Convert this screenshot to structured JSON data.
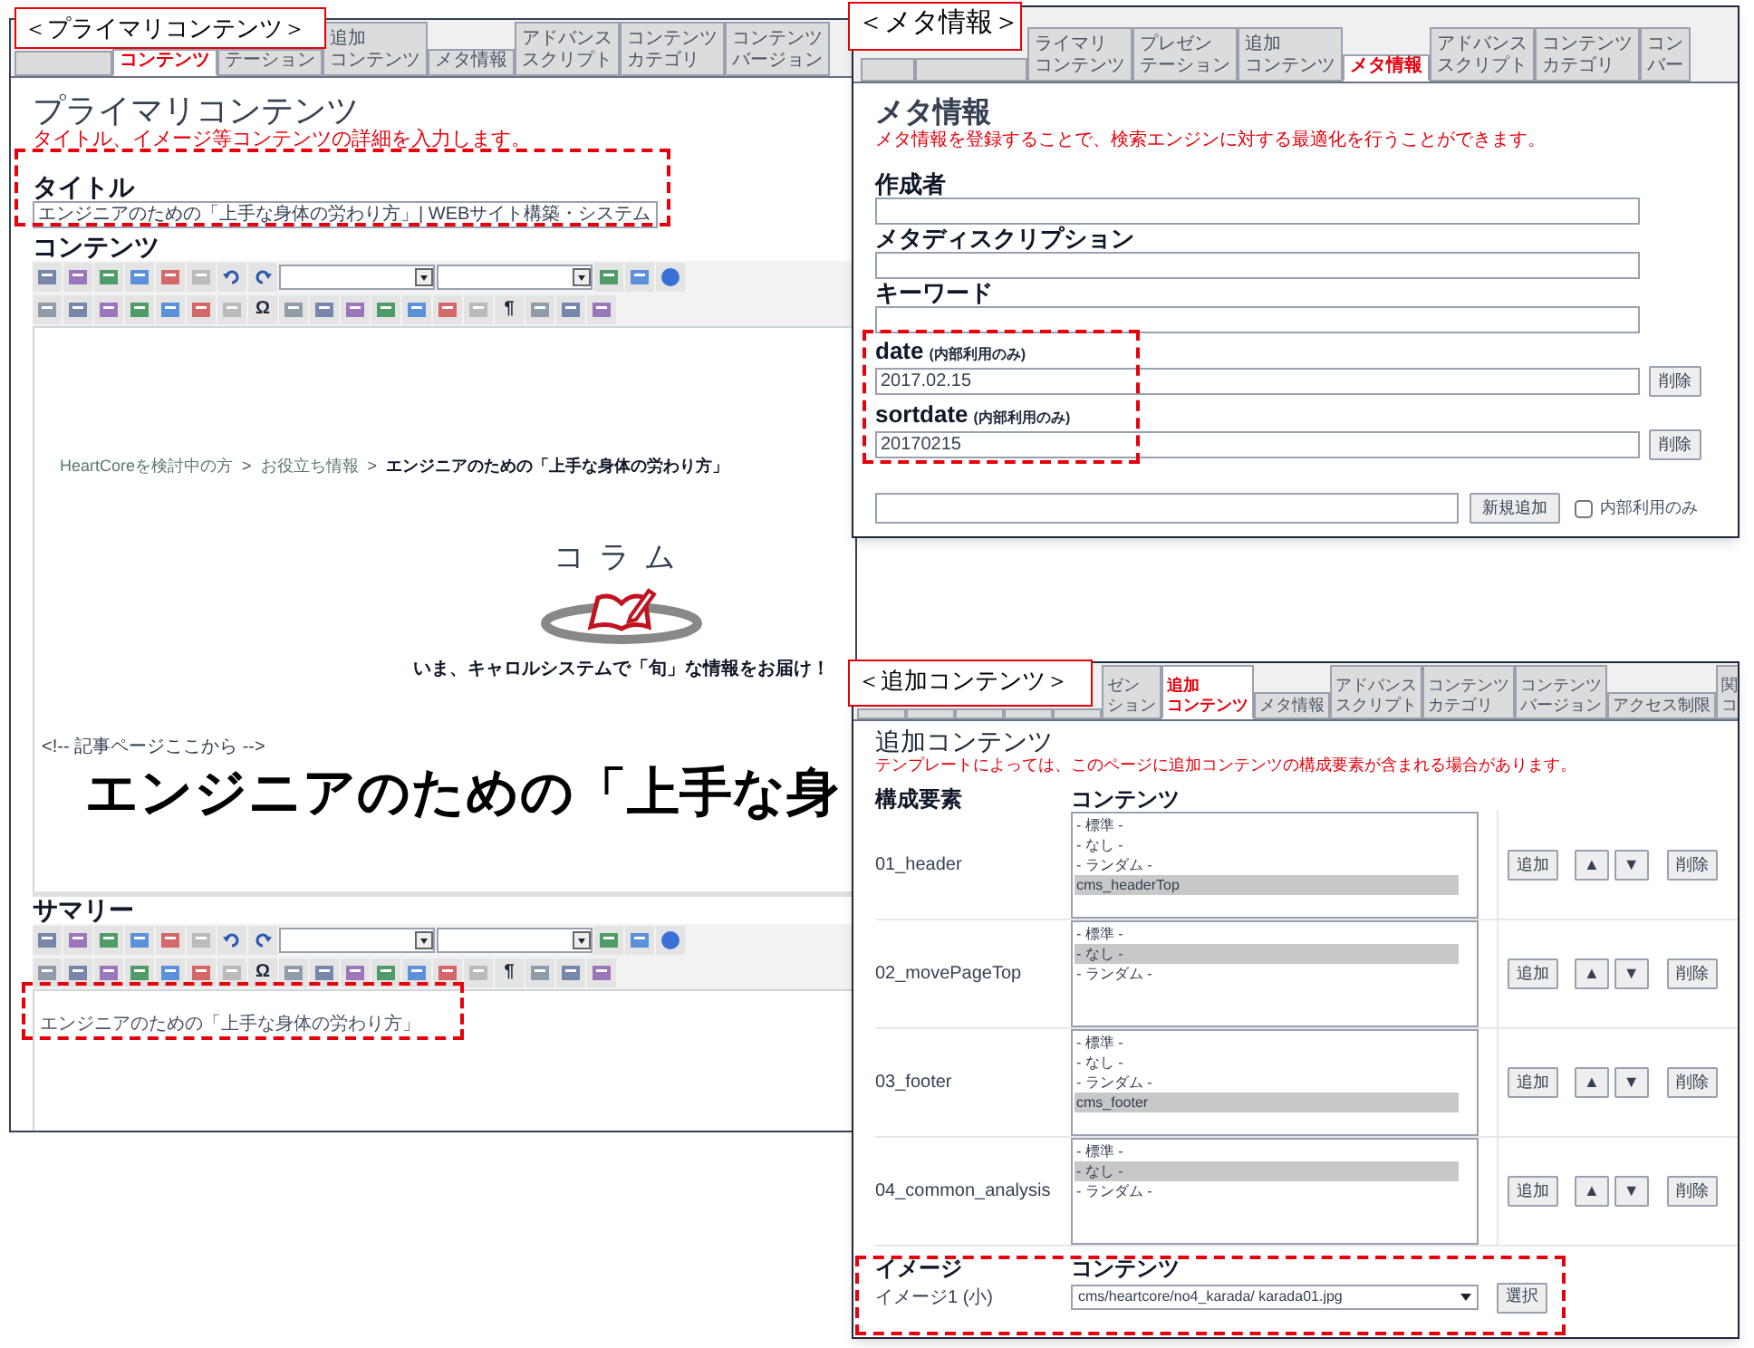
{
  "panels": [
    {
      "kind": "primary",
      "label": "＜プライマリコンテンツ＞",
      "tabs": [
        {
          "lines": [
            "コンテンツ"
          ],
          "selected": true
        },
        {
          "lines": [
            "テーション"
          ],
          "selected": false
        },
        {
          "lines": [
            "追加",
            "コンテンツ"
          ],
          "selected": false
        },
        {
          "lines": [
            "メタ情報"
          ],
          "selected": false
        },
        {
          "lines": [
            "アドバンス",
            "スクリプト"
          ],
          "selected": false
        },
        {
          "lines": [
            "コンテンツ",
            "カテゴリ"
          ],
          "selected": false
        },
        {
          "lines": [
            "コンテンツ",
            "バージョン"
          ],
          "selected": false
        }
      ],
      "title": "プライマリコンテンツ",
      "description": "タイトル、イメージ等コンテンツの詳細を入力します。",
      "title_field": {
        "label": "タイトル",
        "value": "エンジニアのための「上手な身体の労わり方」| WEBサイト構築・システム"
      },
      "content_label": "コンテンツ",
      "toolbar_symbols": [
        "Ω",
        "¶"
      ],
      "editor": {
        "separator": ">",
        "breadcrumb": [
          {
            "text": "HeartCoreを検討中の方",
            "current": false
          },
          {
            "text": "お役立ち情報",
            "current": false
          },
          {
            "text": "エンジニアのための「上手な身体の労わり方」",
            "current": true
          }
        ],
        "logo_text": "コラム",
        "tagline": "いま、キャロルシステムで「旬」な情報をお届け！",
        "comment": "<!-- 記事ページここから -->",
        "heading": "エンジニアのための「上手な身"
      },
      "summary_label": "サマリー",
      "summary_toolbar_symbols": [
        "Ω",
        "¶"
      ],
      "summary_text": "エンジニアのための「上手な身体の労わり方」"
    },
    {
      "kind": "meta",
      "label": "＜メタ情報＞",
      "tabs": [
        {
          "lines": [
            "ライマリ",
            "コンテンツ"
          ],
          "selected": false
        },
        {
          "lines": [
            "プレゼン",
            "テーション"
          ],
          "selected": false
        },
        {
          "lines": [
            "追加",
            "コンテンツ"
          ],
          "selected": false
        },
        {
          "lines": [
            "メタ情報"
          ],
          "selected": true
        },
        {
          "lines": [
            "アドバンス",
            "スクリプト"
          ],
          "selected": false
        },
        {
          "lines": [
            "コンテンツ",
            "カテゴリ"
          ],
          "selected": false
        },
        {
          "lines": [
            "コン",
            "バー"
          ],
          "selected": false
        }
      ],
      "title": "メタ情報",
      "description": "メタ情報を登録することで、検索エンジンに対する最適化を行うことができます。",
      "fields": [
        {
          "label": "作成者"
        },
        {
          "label": "メタディスクリプション"
        },
        {
          "label": "キーワード"
        }
      ],
      "custom_fields": [
        {
          "label": "date",
          "note": "(内部利用のみ)",
          "value": "2017.02.15",
          "button": "削除"
        },
        {
          "label": "sortdate",
          "note": "(内部利用のみ)",
          "value": "20170215",
          "button": "削除"
        }
      ],
      "new_field": {
        "button": "新規追加",
        "checkbox_label": "内部利用のみ",
        "checked": false
      }
    },
    {
      "kind": "additional",
      "label": "＜追加コンテンツ＞",
      "tabs": [
        {
          "lines": [
            "ゼン",
            "ション"
          ],
          "selected": false
        },
        {
          "lines": [
            "追加",
            "コンテンツ"
          ],
          "selected": true
        },
        {
          "lines": [
            "メタ情報"
          ],
          "selected": false
        },
        {
          "lines": [
            "アドバンス",
            "スクリプト"
          ],
          "selected": false
        },
        {
          "lines": [
            "コンテンツ",
            "カテゴリ"
          ],
          "selected": false
        },
        {
          "lines": [
            "コンテンツ",
            "バージョン"
          ],
          "selected": false
        },
        {
          "lines": [
            "アクセス制限"
          ],
          "selected": false
        },
        {
          "lines": [
            "関",
            "コ"
          ],
          "selected": false
        }
      ],
      "title": "追加コンテンツ",
      "description": "テンプレートによっては、このページに追加コンテンツの構成要素が含まれる場合があります。",
      "columns": [
        "構成要素",
        "コンテンツ"
      ],
      "rows": [
        {
          "name": "01_header",
          "options": [
            {
              "text": "- 標準 -",
              "selected": false
            },
            {
              "text": "- なし -",
              "selected": false
            },
            {
              "text": "- ランダム -",
              "selected": false
            },
            {
              "text": "cms_headerTop",
              "selected": true
            }
          ],
          "buttons": [
            "追加",
            "▲",
            "▼",
            "削除"
          ]
        },
        {
          "name": "02_movePageTop",
          "options": [
            {
              "text": "- 標準 -",
              "selected": false
            },
            {
              "text": "- なし -",
              "selected": true
            },
            {
              "text": "- ランダム -",
              "selected": false
            }
          ],
          "buttons": [
            "追加",
            "▲",
            "▼",
            "削除"
          ]
        },
        {
          "name": "03_footer",
          "options": [
            {
              "text": "- 標準 -",
              "selected": false
            },
            {
              "text": "- なし -",
              "selected": false
            },
            {
              "text": "- ランダム -",
              "selected": false
            },
            {
              "text": "cms_footer",
              "selected": true
            }
          ],
          "buttons": [
            "追加",
            "▲",
            "▼",
            "削除"
          ]
        },
        {
          "name": "04_common_analysis",
          "options": [
            {
              "text": "- 標準 -",
              "selected": false
            },
            {
              "text": "- なし -",
              "selected": true
            },
            {
              "text": "- ランダム -",
              "selected": false
            }
          ],
          "buttons": [
            "追加",
            "▲",
            "▼",
            "削除"
          ]
        }
      ],
      "image_columns": [
        "イメージ",
        "コンテンツ"
      ],
      "image_row": {
        "name": "イメージ1 (小)",
        "value": "cms/heartcore/no4_karada/ karada01.jpg",
        "button": "選択"
      }
    }
  ]
}
